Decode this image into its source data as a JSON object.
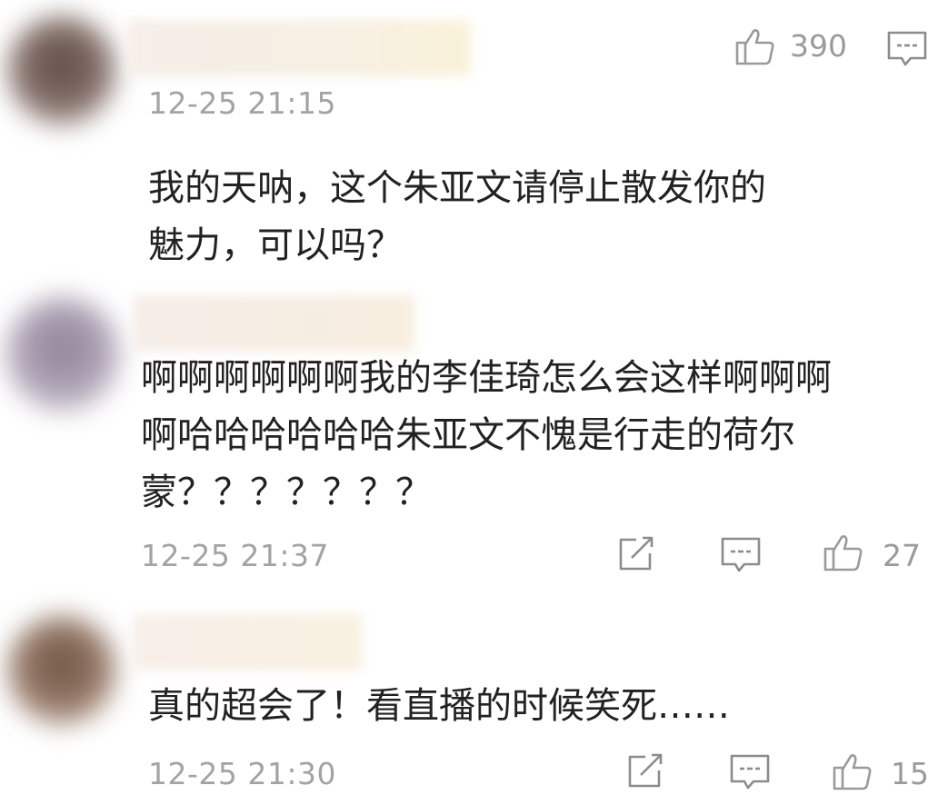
{
  "comments": [
    {
      "time": "12-25 21:15",
      "text_lines": [
        "我的天呐，这个朱亚文请停止散发你的",
        "魅力，可以吗？"
      ],
      "like_count": "390",
      "icons": [
        "thumbs-up-icon",
        "comment-icon"
      ]
    },
    {
      "time": "12-25 21:37",
      "text_lines": [
        "啊啊啊啊啊啊我的李佳琦怎么会这样啊啊啊",
        "啊哈哈哈哈哈哈朱亚文不愧是行走的荷尔",
        "蒙？？？？？？？"
      ],
      "like_count": "27",
      "icons": [
        "share-icon",
        "comment-icon",
        "thumbs-up-icon"
      ]
    },
    {
      "time": "12-25 21:30",
      "text_lines": [
        "真的超会了！看直播的时候笑死……"
      ],
      "like_count": "15",
      "icons": [
        "share-icon",
        "comment-icon",
        "thumbs-up-icon"
      ]
    }
  ],
  "colors": {
    "text": "#222222",
    "meta": "#a3a3a3",
    "icon": "#9a9a9a"
  }
}
